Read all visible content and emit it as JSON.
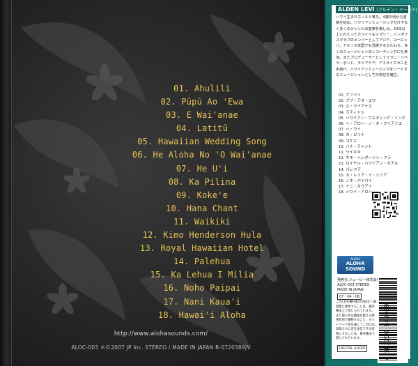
{
  "tracks": [
    "01. Ahulili",
    "02. Pūpū Ao 'Ewa",
    "03. E Wai'anae",
    "04. Latitū",
    "05. Hawaiian Wedding Song",
    "06. He Aloha No 'O Wai'anae",
    "07. He U'i",
    "08. Ka Pilina",
    "09. Koke'e",
    "10. Hana Chant",
    "11. Waikiki",
    "12. Kimo Henderson Hula",
    "13. Royal Hawaiian Hotel",
    "14. Palehua",
    "15. Ka Lehua I Milia",
    "16. Noho Paipai",
    "17. Nani Kaua'i",
    "18. Hawai'i Aloha"
  ],
  "url": "http://www.alohasounds.com/",
  "copyright": "ALOC-003 ℗©2007 JP Inc. STEREO / MADE IN JAPAN R-0720389JV",
  "obi": {
    "artist": "ALDEN LEVI",
    "artist_jp": "(アルデン・リーバイ)",
    "description": "ハワイ生まれホノルル育ち。4歳の頃から音楽を始め、ハワイアンミュージックだけでなく多くのジャンルの音楽を楽しみ、20年以上にわたってカワイイ＆ジプシー、バンダナスクラブのメンバーとしてアジア、ヨーロッパ、アメリカ本国でも活躍するかたわら、多くのミュージシャンのレコーディングにも参加。またプロデューサーとしてイラニ・リベラ・ボンド、ライアテア、アネライカラニを手掛け、ハワイアンミュージックをリードするミュージシャンとしての地位を確立。",
    "tracks_jp": [
      "01. アフリリ",
      "02. プブ・アオ・エワ",
      "03. エ・ワイアナエ",
      "04. ラティトゥ",
      "05. ハワイアン・ウエディング・ソング",
      "06. ヘ・アロハ・ノ・オ・ワイアナエ",
      "07. ヘ・ウイ",
      "08. カ・ピリナ",
      "09. コケエ",
      "10. ハナ・チャント",
      "11. ワイキキ",
      "12. キモ・ヘンダーソン・フラ",
      "13. ロイヤル・ハワイアン・ホテル",
      "14. パレフア",
      "15. カ・レフア・イ・ミリア",
      "16. ノホ・パイパイ",
      "17. ナニ・カウアイ",
      "18. ハワイ・アロハ"
    ],
    "badge_small": "ALOHA",
    "badge_line1": "ALOHA",
    "badge_line2": "SOUND",
    "company": "発売元:ジェーピー株式会社\nALOC-003 STEREO\nMADE IN JAPAN",
    "date": "07・04・08",
    "note": "このCDを権利者の許諾なく賃貸業に使用することは、著作権法上で禁じられています。また個人的な範囲を越える使用目的で複製すること、ネットワーク等を通じてこのCDに収録された音を送信できる状態にすることは、著作権法で禁じられています。",
    "cd_logo": "DIGITAL AUDIO",
    "barcode_digits": "4 582230 840039"
  },
  "colors": {
    "track_gold": "#e8c458",
    "obi_teal": "#136e68"
  }
}
